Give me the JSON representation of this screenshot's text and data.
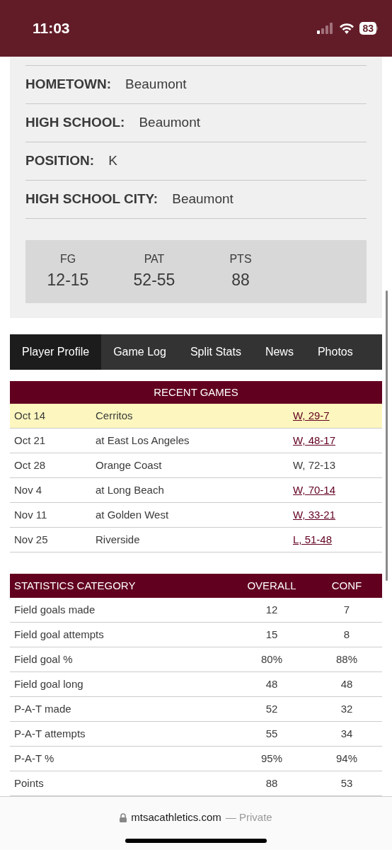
{
  "status_bar": {
    "time": "11:03",
    "battery": "83"
  },
  "profile": {
    "fields": [
      {
        "label": "HOMETOWN:",
        "value": "Beaumont"
      },
      {
        "label": "HIGH SCHOOL:",
        "value": "Beaumont"
      },
      {
        "label": "POSITION:",
        "value": "K"
      },
      {
        "label": "HIGH SCHOOL CITY:",
        "value": "Beaumont"
      }
    ],
    "summary": [
      {
        "label": "FG",
        "value": "12-15"
      },
      {
        "label": "PAT",
        "value": "52-55"
      },
      {
        "label": "PTS",
        "value": "88"
      }
    ]
  },
  "tabs": [
    {
      "label": "Player Profile",
      "selected": true
    },
    {
      "label": "Game Log",
      "selected": false
    },
    {
      "label": "Split Stats",
      "selected": false
    },
    {
      "label": "News",
      "selected": false
    },
    {
      "label": "Photos",
      "selected": false
    }
  ],
  "recent_games": {
    "title": "RECENT GAMES",
    "rows": [
      {
        "date": "Oct 14",
        "opponent": "Cerritos",
        "result": "W, 29-7",
        "linked": true,
        "highlighted": true
      },
      {
        "date": "Oct 21",
        "opponent": "at East Los Angeles",
        "result": "W, 48-17",
        "linked": true,
        "highlighted": false
      },
      {
        "date": "Oct 28",
        "opponent": "Orange Coast",
        "result": "W, 72-13",
        "linked": false,
        "highlighted": false
      },
      {
        "date": "Nov 4",
        "opponent": "at Long Beach",
        "result": "W, 70-14",
        "linked": true,
        "highlighted": false
      },
      {
        "date": "Nov 11",
        "opponent": "at Golden West",
        "result": "W, 33-21",
        "linked": true,
        "highlighted": false
      },
      {
        "date": "Nov 25",
        "opponent": "Riverside",
        "result": "L, 51-48",
        "linked": true,
        "highlighted": false
      }
    ]
  },
  "stats_table": {
    "columns": [
      "STATISTICS CATEGORY",
      "OVERALL",
      "CONF"
    ],
    "rows": [
      [
        "Field goals made",
        "12",
        "7"
      ],
      [
        "Field goal attempts",
        "15",
        "8"
      ],
      [
        "Field goal %",
        "80%",
        "88%"
      ],
      [
        "Field goal long",
        "48",
        "48"
      ],
      [
        "P-A-T made",
        "52",
        "32"
      ],
      [
        "P-A-T attempts",
        "55",
        "34"
      ],
      [
        "P-A-T %",
        "95%",
        "94%"
      ],
      [
        "Points",
        "88",
        "53"
      ]
    ]
  },
  "address_bar": {
    "domain": "mtsacathletics.com",
    "suffix": "— Private"
  }
}
